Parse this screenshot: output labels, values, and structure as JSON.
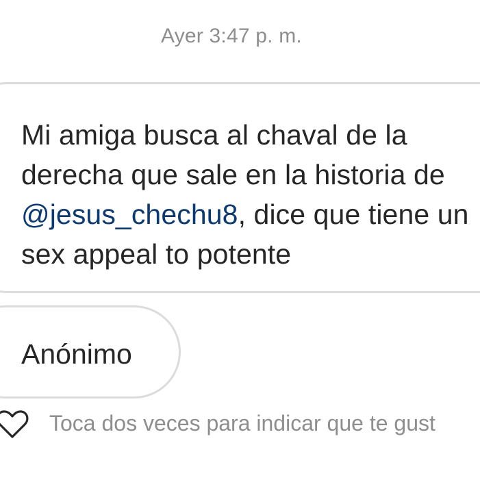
{
  "conversation": {
    "timestamp": "Ayer 3:47 p. m.",
    "message": {
      "text_before_mention": "Mi amiga busca al chaval de la derecha que sale en la historia de ",
      "mention": "@jesus_chechu8",
      "text_after_mention": ", dice que tiene un sex appeal to potente"
    },
    "sender_label": "Anónimo",
    "reaction_hint": "Toca dos veces para indicar que te gust"
  },
  "icons": {
    "reaction": "heart-outline-icon"
  },
  "colors": {
    "background": "#ffffff",
    "bubble_border": "#dcdcdc",
    "message_text": "#262626",
    "mention_text": "#0f3a6e",
    "secondary_text": "#8e8e8e"
  }
}
